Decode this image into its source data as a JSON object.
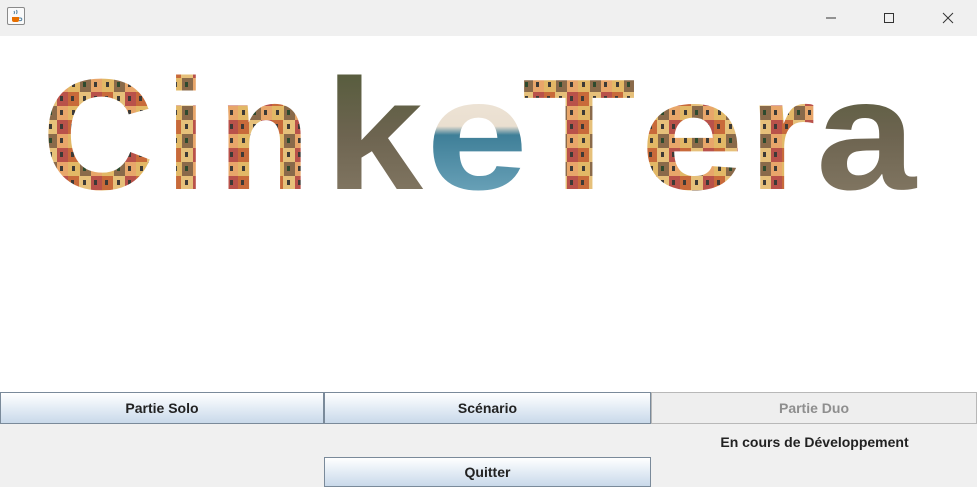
{
  "window": {
    "app_icon": "java-coffee-icon",
    "controls": [
      "minimize-icon",
      "maximize-icon",
      "close-icon"
    ]
  },
  "logo": {
    "text": "CinkeTera",
    "fill": "photo-collage"
  },
  "menu": {
    "solo_label": "Partie Solo",
    "scenario_label": "Scénario",
    "duo_label": "Partie Duo",
    "duo_status": "En cours de Développement",
    "quit_label": "Quitter"
  },
  "colors": {
    "window_bg": "#f0f0f0",
    "canvas_bg": "#ffffff",
    "button_border": "#7a8a9a",
    "disabled_text": "#8e8e8e"
  }
}
